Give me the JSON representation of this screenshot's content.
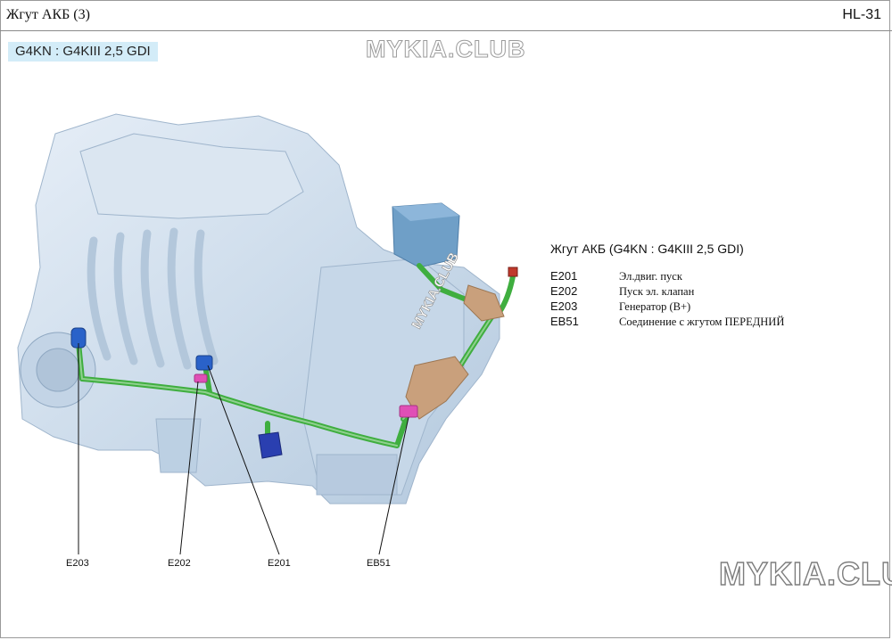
{
  "header": {
    "title": "Жгут  АКБ  (3)",
    "page": "HL-31"
  },
  "engine_tag": "G4KN : G4KIII 2,5 GDI",
  "watermark": {
    "top": "MYKIA.CLUB",
    "side": "MYKIA.CLUB",
    "bottom": "MYKIA.CLUB"
  },
  "legend": {
    "title": "Жгут  АКБ  (G4KN : G4KIII 2,5 GDI)",
    "items": [
      {
        "code": "E201",
        "desc": "Эл.двиг. пуск"
      },
      {
        "code": "E202",
        "desc": "Пуск  эл. клапан"
      },
      {
        "code": "E203",
        "desc": "Генератор    (B+)"
      },
      {
        "code": "EB51",
        "desc": "Соединение    с жгутом  ПЕРЕДНИЙ"
      }
    ]
  },
  "callouts": [
    "E203",
    "E202",
    "E201",
    "EB51"
  ],
  "colors": {
    "harness": "#3fae3f",
    "engine": "#cfdfee",
    "engine_shade": "#a9c2da",
    "connector_blue": "#2a62c9",
    "connector_pink": "#e04fb6",
    "bracket": "#c9a07c",
    "fusebox": "#6f9fc7",
    "tag_bg": "#d3ecf8"
  }
}
